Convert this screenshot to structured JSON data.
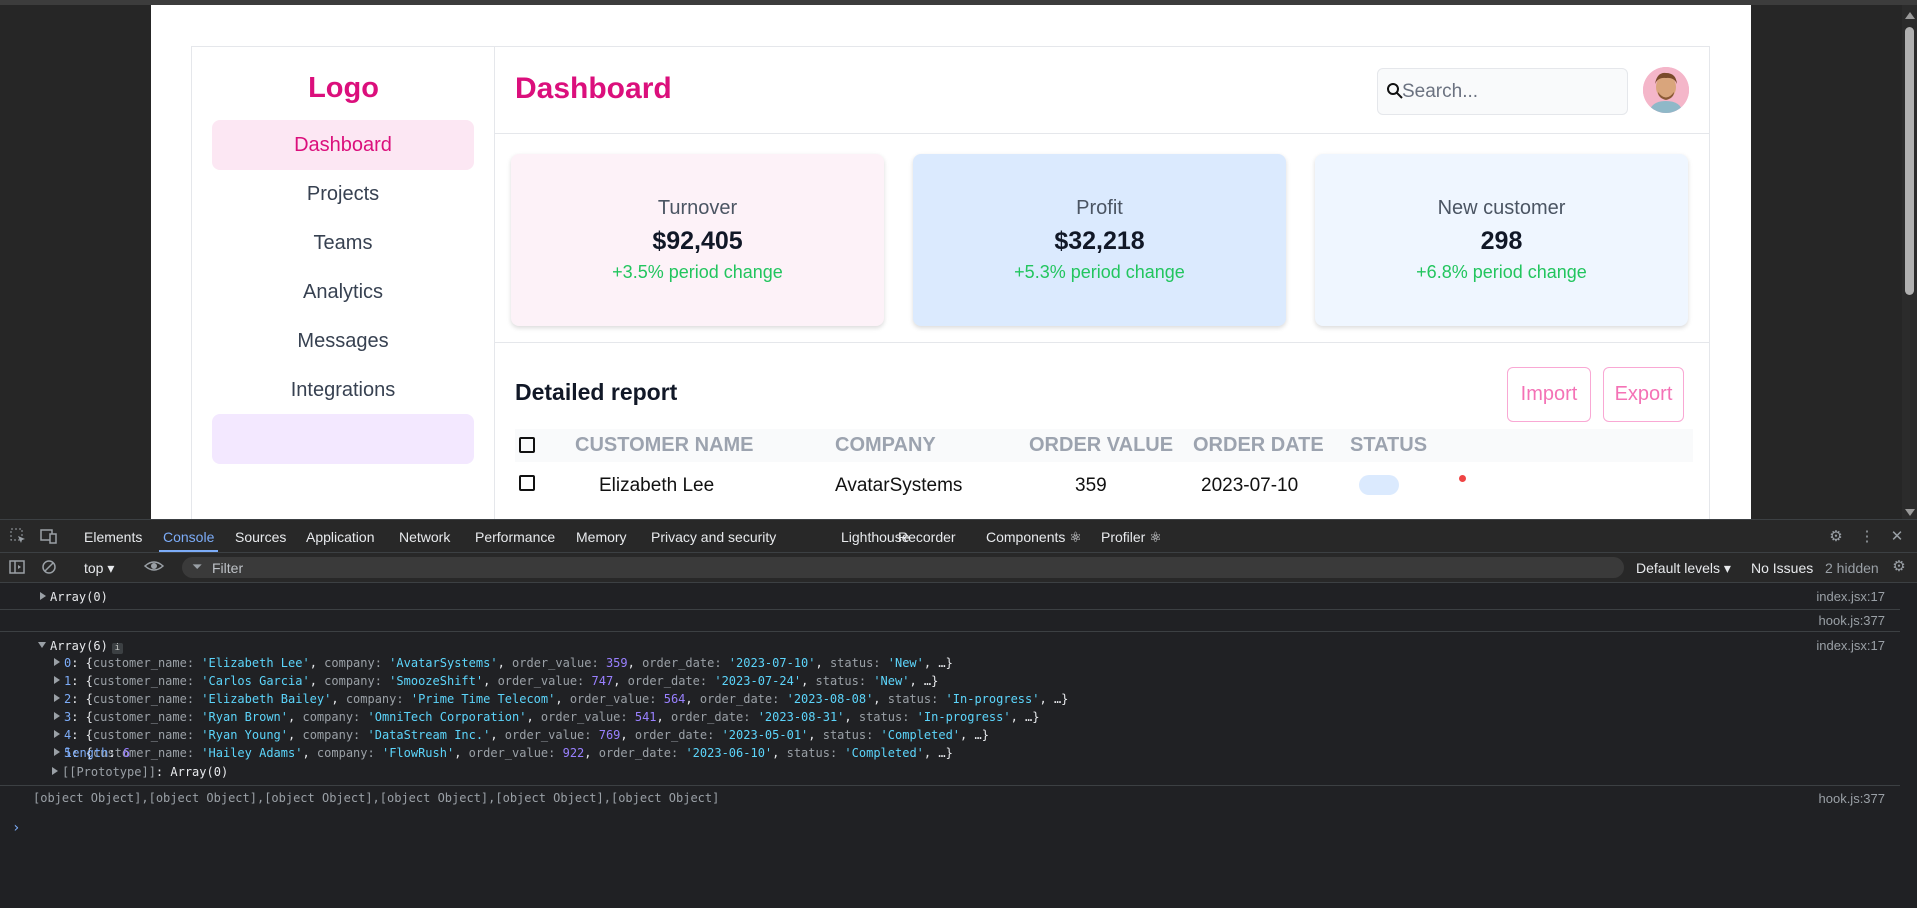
{
  "app": {
    "logo": "Logo",
    "nav": [
      "Dashboard",
      "Projects",
      "Teams",
      "Analytics",
      "Messages",
      "Integrations"
    ],
    "header": {
      "title": "Dashboard",
      "search_placeholder": "Search..."
    },
    "cards": [
      {
        "label": "Turnover",
        "value": "$92,405",
        "change": "+3.5% period change",
        "bg": "#fdf2f8"
      },
      {
        "label": "Profit",
        "value": "$32,218",
        "change": "+5.3% period change",
        "bg": "#dbeafe"
      },
      {
        "label": "New customer",
        "value": "298",
        "change": "+6.8% period change",
        "bg": "#eff6ff"
      }
    ],
    "report": {
      "title": "Detailed report",
      "import_label": "Import",
      "export_label": "Export",
      "columns": [
        "CUSTOMER NAME",
        "COMPANY",
        "ORDER VALUE",
        "ORDER DATE",
        "STATUS"
      ]
    }
  },
  "devtools": {
    "tabs": [
      "Elements",
      "Console",
      "Sources",
      "Application",
      "Network",
      "Performance",
      "Memory",
      "Privacy and security",
      "Lighthouse",
      "Recorder",
      "Components ⚛",
      "Profiler ⚛"
    ],
    "active_tab": "Console",
    "toolbar": {
      "context": "top ▾",
      "filter_placeholder": "Filter",
      "levels": "Default levels ▾",
      "issues": "No Issues",
      "hidden": "2 hidden"
    },
    "console": {
      "entry1": {
        "text": "Array(0)",
        "source": "index.jsx:17"
      },
      "entry2": {
        "source": "hook.js:377"
      },
      "entry3": {
        "text": "Array(6)",
        "source": "index.jsx:17"
      },
      "rows": [
        {
          "idx": "0",
          "customer_name": "Elizabeth Lee",
          "company": "AvatarSystems",
          "order_value": "359",
          "order_date": "2023-07-10",
          "status": "New"
        },
        {
          "idx": "1",
          "customer_name": "Carlos Garcia",
          "company": "SmoozeShift",
          "order_value": "747",
          "order_date": "2023-07-24",
          "status": "New"
        },
        {
          "idx": "2",
          "customer_name": "Elizabeth Bailey",
          "company": "Prime Time Telecom",
          "order_value": "564",
          "order_date": "2023-08-08",
          "status": "In-progress"
        },
        {
          "idx": "3",
          "customer_name": "Ryan Brown",
          "company": "OmniTech Corporation",
          "order_value": "541",
          "order_date": "2023-08-31",
          "status": "In-progress"
        },
        {
          "idx": "4",
          "customer_name": "Ryan Young",
          "company": "DataStream Inc.",
          "order_value": "769",
          "order_date": "2023-05-01",
          "status": "Completed"
        },
        {
          "idx": "5",
          "customer_name": "Hailey Adams",
          "company": "FlowRush",
          "order_value": "922",
          "order_date": "2023-06-10",
          "status": "Completed"
        }
      ],
      "length_label": "length",
      "length_value": "6",
      "prototype_label": "[[Prototype]]",
      "prototype_value": "Array(0)",
      "object_line": "[object Object],[object Object],[object Object],[object Object],[object Object],[object Object]",
      "object_source": "hook.js:377"
    }
  }
}
